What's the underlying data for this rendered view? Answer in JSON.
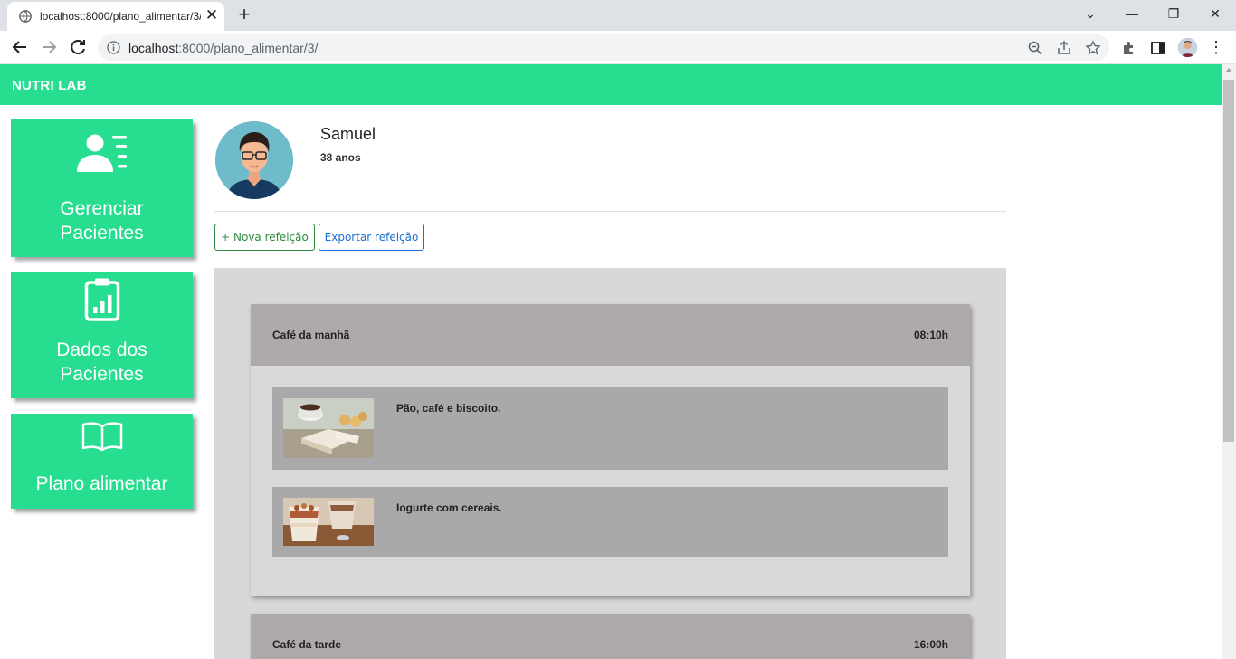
{
  "browser": {
    "tab_title": "localhost:8000/plano_alimentar/3/",
    "url_host": "localhost",
    "url_rest": ":8000/plano_alimentar/3/"
  },
  "app": {
    "brand": "NUTRI LAB",
    "accent_color": "#27dd8f"
  },
  "sidebar": {
    "items": [
      {
        "label_line1": "Gerenciar",
        "label_line2": "Pacientes",
        "icon": "patients-list-icon"
      },
      {
        "label_line1": "Dados dos",
        "label_line2": "Pacientes",
        "icon": "clipboard-chart-icon"
      },
      {
        "label_line1": "Plano alimentar",
        "label_line2": "",
        "icon": "open-book-icon"
      }
    ]
  },
  "patient": {
    "name": "Samuel",
    "age": "38 anos"
  },
  "actions": {
    "new_meal": "+ Nova refeição",
    "export_meal": "Exportar refeição"
  },
  "meals": [
    {
      "title": "Café da manhã",
      "time": "08:10h",
      "foods": [
        {
          "name": "Pão, café e biscoito."
        },
        {
          "name": "Iogurte com cereais."
        }
      ]
    },
    {
      "title": "Café da tarde",
      "time": "16:00h",
      "foods": []
    }
  ]
}
